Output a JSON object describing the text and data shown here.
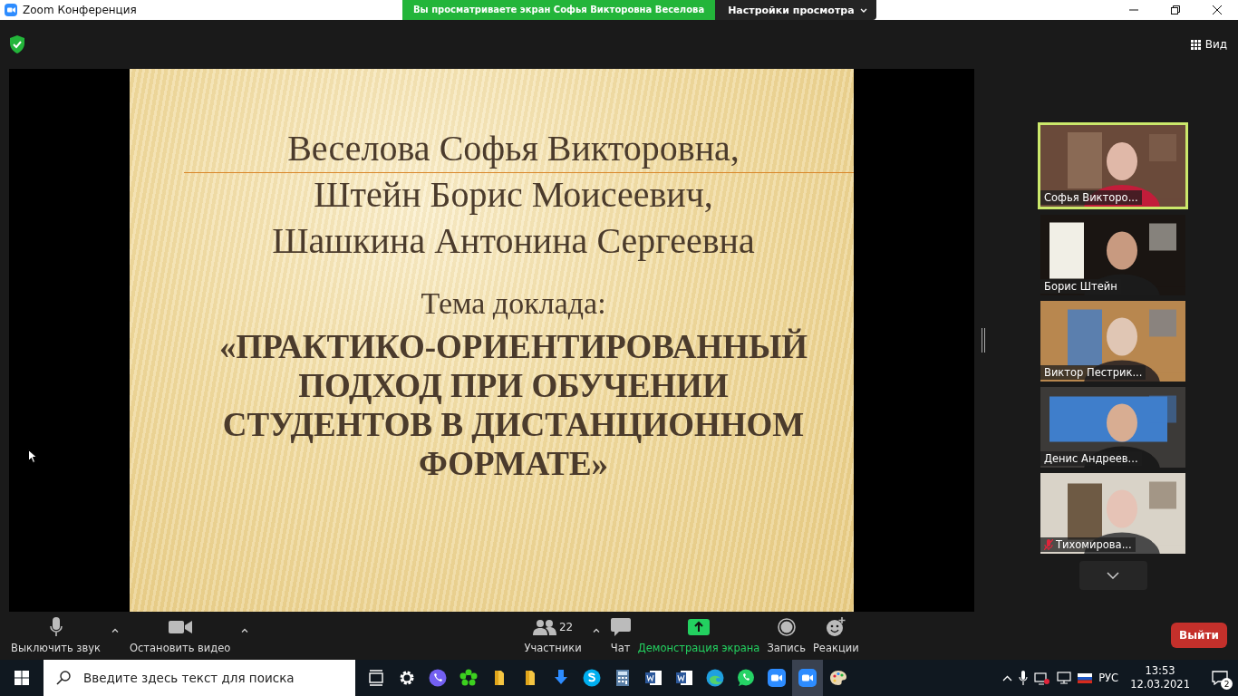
{
  "window": {
    "title": "Zoom Конференция"
  },
  "banner": {
    "text": "Вы просматриваете экран Софья  Викторовна Веселова",
    "settings": "Настройки просмотра"
  },
  "header": {
    "view": "Вид"
  },
  "slide": {
    "authors": [
      "Веселова Софья Викторовна,",
      "Штейн Борис Моисеевич,",
      "Шашкина Антонина Сергеевна"
    ],
    "topic_label": "Тема доклада:",
    "topic_lines": [
      "«ПРАКТИКО-ОРИЕНТИРОВАННЫЙ",
      "ПОДХОД ПРИ ОБУЧЕНИИ",
      "СТУДЕНТОВ В ДИСТАНЦИОННОМ",
      "ФОРМАТЕ»"
    ]
  },
  "participants": [
    {
      "name": "Софья Викторо...",
      "selected": true,
      "muted": false
    },
    {
      "name": "Борис Штейн",
      "selected": false,
      "muted": false
    },
    {
      "name": "Виктор Пестрик...",
      "selected": false,
      "muted": false
    },
    {
      "name": "Денис Андреев...",
      "selected": false,
      "muted": false
    },
    {
      "name": "Тихомирова...",
      "selected": false,
      "muted": true
    }
  ],
  "toolbar": {
    "left": [
      {
        "kind": "mic",
        "label": "Выключить звук",
        "caret": true
      },
      {
        "kind": "video",
        "label": "Остановить видео",
        "caret": true
      }
    ],
    "center": [
      {
        "kind": "participants",
        "label": "Участники",
        "count": "22",
        "caret": true
      },
      {
        "kind": "chat",
        "label": "Чат",
        "caret": false
      },
      {
        "kind": "share",
        "label": "Демонстрация экрана",
        "caret": false
      },
      {
        "kind": "record",
        "label": "Запись",
        "caret": false
      },
      {
        "kind": "reactions",
        "label": "Реакции",
        "caret": false
      }
    ],
    "leave": "Выйти"
  },
  "taskbar": {
    "search_placeholder": "Введите здесь текст для поиска",
    "apps": [
      {
        "kind": "taskview",
        "selected": false
      },
      {
        "kind": "settings",
        "selected": false
      },
      {
        "kind": "viber",
        "selected": false
      },
      {
        "kind": "icq",
        "selected": false
      },
      {
        "kind": "folder",
        "selected": false
      },
      {
        "kind": "folder",
        "selected": false
      },
      {
        "kind": "download",
        "selected": false
      },
      {
        "kind": "skype",
        "selected": false
      },
      {
        "kind": "calculator",
        "selected": false
      },
      {
        "kind": "word",
        "selected": false
      },
      {
        "kind": "word",
        "selected": false
      },
      {
        "kind": "edge",
        "selected": false
      },
      {
        "kind": "whatsapp",
        "selected": false
      },
      {
        "kind": "zoom",
        "selected": false
      },
      {
        "kind": "zoom",
        "selected": true
      },
      {
        "kind": "paint",
        "selected": false
      }
    ],
    "language": "РУС",
    "time": "13:53",
    "date": "12.03.2021",
    "notifications": "2"
  }
}
